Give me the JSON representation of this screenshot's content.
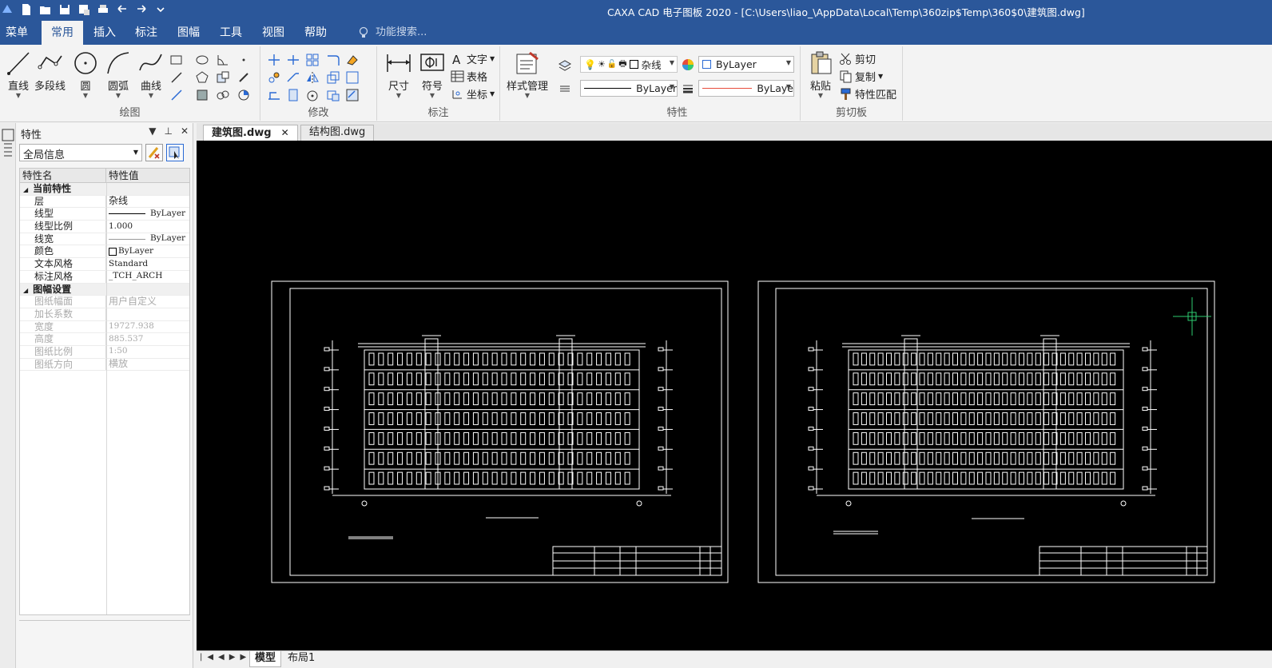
{
  "window": {
    "title": "CAXA CAD 电子图板 2020 - [C:\\Users\\liao_\\AppData\\Local\\Temp\\360zip$Temp\\360$0\\建筑图.dwg]"
  },
  "menu": {
    "tabs": [
      "菜单",
      "常用",
      "插入",
      "标注",
      "图幅",
      "工具",
      "视图",
      "帮助"
    ],
    "active": "常用",
    "search_label": "功能搜索..."
  },
  "ribbon": {
    "draw": {
      "label": "绘图",
      "buttons": [
        "直线",
        "多段线",
        "圆",
        "圆弧",
        "曲线"
      ]
    },
    "modify": {
      "label": "修改"
    },
    "annotate": {
      "label": "标注",
      "buttons": [
        "尺寸",
        "符号"
      ],
      "small": [
        "文字",
        "表格",
        "坐标"
      ]
    },
    "style": {
      "label": "样式管理"
    },
    "properties": {
      "label": "特性",
      "layer_value": "杂线",
      "color_value": "ByLayer",
      "linetype_value": "ByLayer",
      "lineweight_value": "ByLaye"
    },
    "clipboard": {
      "label": "剪切板",
      "paste": "粘贴",
      "cut": "剪切",
      "copy": "复制",
      "match": "特性匹配"
    }
  },
  "panel": {
    "title": "特性",
    "scope": "全局信息",
    "header_name": "特性名",
    "header_value": "特性值",
    "categories": [
      {
        "name": "当前特性",
        "rows": [
          {
            "k": "层",
            "v": "杂线"
          },
          {
            "k": "线型",
            "v": "ByLayer"
          },
          {
            "k": "线型比例",
            "v": "1.000"
          },
          {
            "k": "线宽",
            "v": "ByLayer"
          },
          {
            "k": "颜色",
            "v": "ByLayer"
          },
          {
            "k": "文本风格",
            "v": "Standard"
          },
          {
            "k": "标注风格",
            "v": "_TCH_ARCH"
          }
        ]
      },
      {
        "name": "图幅设置",
        "rows": [
          {
            "k": "图纸幅面",
            "v": "用户自定义"
          },
          {
            "k": "加长系数",
            "v": ""
          },
          {
            "k": "宽度",
            "v": "19727.938"
          },
          {
            "k": "高度",
            "v": "885.537"
          },
          {
            "k": "图纸比例",
            "v": "1:50"
          },
          {
            "k": "图纸方向",
            "v": "横放"
          }
        ]
      }
    ]
  },
  "documents": {
    "tabs": [
      "建筑图.dwg",
      "结构图.dwg"
    ],
    "active": "建筑图.dwg"
  },
  "layouts": {
    "tabs": [
      "模型",
      "布局1"
    ],
    "active": "模型"
  },
  "colors": {
    "accent": "#2b579a",
    "canvas": "#000000",
    "drawing": "#ffffff",
    "cursor": "#2ecc71"
  }
}
